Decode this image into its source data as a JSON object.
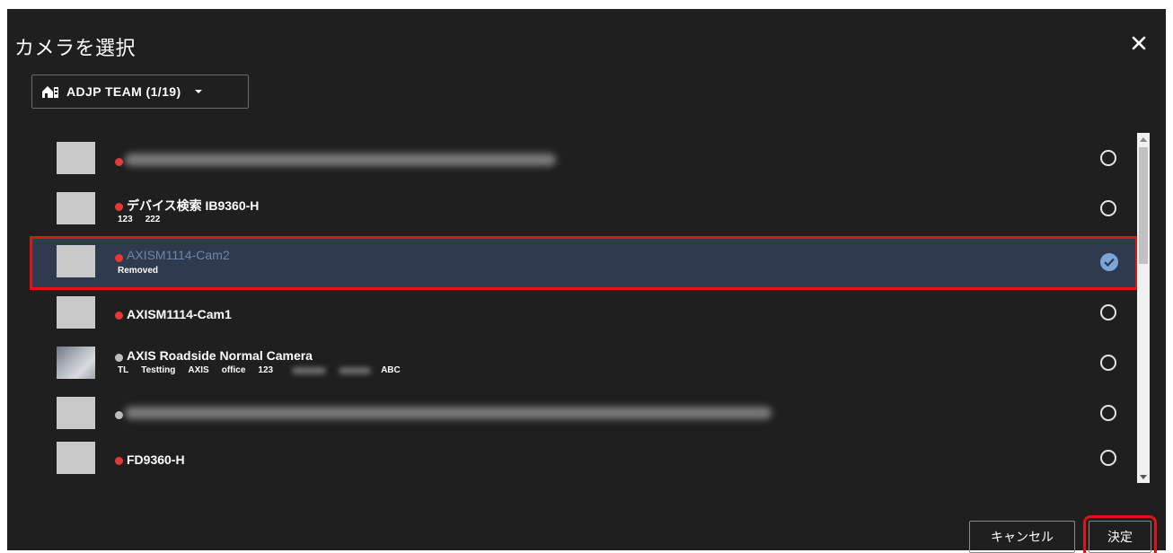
{
  "dialog": {
    "title": "カメラを選択",
    "close_icon": "close-icon",
    "team_selector": {
      "icon": "home-camera-icon",
      "label": "ADJP TEAM (1/19)",
      "caret_icon": "caret-down-icon"
    }
  },
  "cameras": [
    {
      "name": "",
      "status": "red",
      "tags": [],
      "selected": false,
      "blurred": true
    },
    {
      "name": "デバイス検索 IB9360-H",
      "status": "red",
      "tags": [
        "123",
        "222"
      ],
      "selected": false
    },
    {
      "name": "AXISM1114-Cam2",
      "status": "red",
      "tags": [
        "Removed"
      ],
      "selected": true
    },
    {
      "name": "AXISM1114-Cam1",
      "status": "red",
      "tags": [],
      "selected": false
    },
    {
      "name": "AXIS Roadside Normal Camera",
      "status": "grey",
      "tags": [
        "TL",
        "Testting",
        "AXIS",
        "office",
        "123",
        "ABC"
      ],
      "selected": false
    },
    {
      "name": "",
      "status": "grey",
      "tags": [],
      "selected": false,
      "blurred": true
    },
    {
      "name": "FD9360-H",
      "status": "red",
      "tags": [],
      "selected": false
    }
  ],
  "footer": {
    "cancel_label": "キャンセル",
    "ok_label": "決定"
  },
  "colors": {
    "background": "#1f1f1f",
    "selected_row": "#2f3a4f",
    "highlight": "#e01414",
    "status_red": "#e53935",
    "check": "#7aa7d8"
  }
}
